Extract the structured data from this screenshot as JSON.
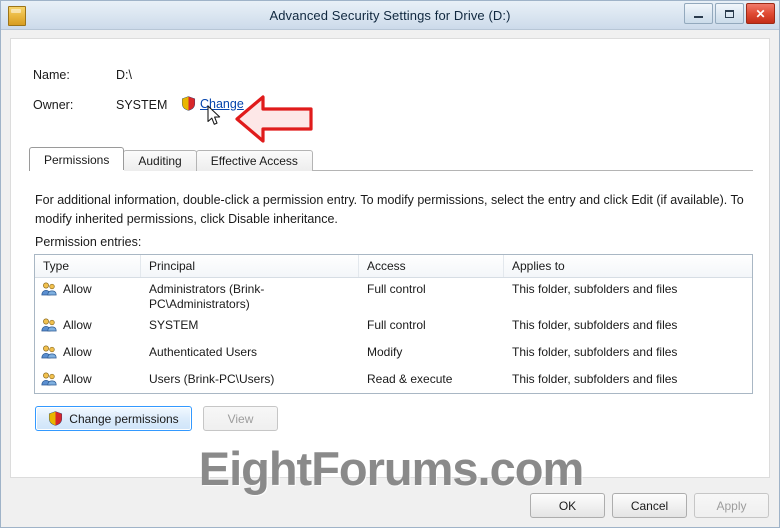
{
  "window": {
    "title": "Advanced Security Settings for Drive (D:)",
    "icon": "drive-icon",
    "controls": {
      "minimize": "minimize-icon",
      "maximize": "maximize-icon",
      "close": "✕"
    }
  },
  "header": {
    "name_label": "Name:",
    "name_value": "D:\\",
    "owner_label": "Owner:",
    "owner_value": "SYSTEM",
    "change_link": "Change",
    "change_shield_icon": "uac-shield-icon",
    "annotation_arrow": "red-arrow-annotation",
    "cursor": "mouse-pointer-icon"
  },
  "tabs": [
    {
      "label": "Permissions",
      "selected": true
    },
    {
      "label": "Auditing",
      "selected": false
    },
    {
      "label": "Effective Access",
      "selected": false
    }
  ],
  "body": {
    "info_text": "For additional information, double-click a permission entry. To modify permissions, select the entry and click Edit (if available). To modify inherited permissions, click Disable inheritance.",
    "entries_label": "Permission entries:"
  },
  "table": {
    "columns": [
      "Type",
      "Principal",
      "Access",
      "Applies to"
    ],
    "rows": [
      {
        "icon": "user-group-icon",
        "type": "Allow",
        "principal": "Administrators (Brink-PC\\Administrators)",
        "access": "Full control",
        "applies_to": "This folder, subfolders and files"
      },
      {
        "icon": "user-group-icon",
        "type": "Allow",
        "principal": "SYSTEM",
        "access": "Full control",
        "applies_to": "This folder, subfolders and files"
      },
      {
        "icon": "user-group-icon",
        "type": "Allow",
        "principal": "Authenticated Users",
        "access": "Modify",
        "applies_to": "This folder, subfolders and files"
      },
      {
        "icon": "user-group-icon",
        "type": "Allow",
        "principal": "Users (Brink-PC\\Users)",
        "access": "Read & execute",
        "applies_to": "This folder, subfolders and files"
      }
    ]
  },
  "actions": {
    "change_permissions": "Change permissions",
    "change_permissions_icon": "uac-shield-icon",
    "view": "View",
    "view_enabled": false
  },
  "watermark": "EightForums.com",
  "footer": {
    "ok": "OK",
    "cancel": "Cancel",
    "apply": "Apply",
    "apply_enabled": false
  },
  "colors": {
    "link": "#0645ad",
    "annotation": "#e01b1b",
    "accent_button_border": "#3399ff",
    "title_text": "#10283f"
  }
}
